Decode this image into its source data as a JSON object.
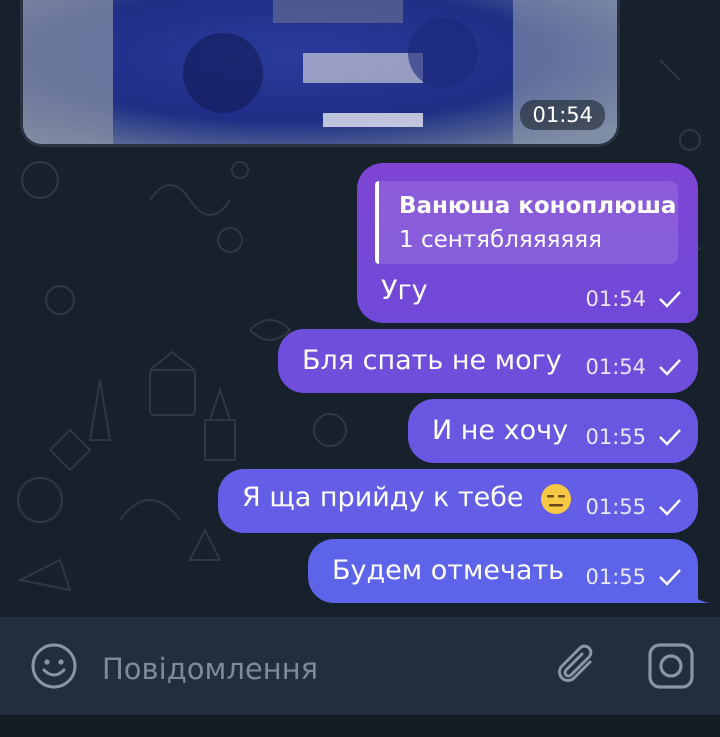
{
  "media_message": {
    "time": "01:54"
  },
  "messages": [
    {
      "reply": {
        "name": "Ванюша коноплюша",
        "text": "1 сентябляяяяяя"
      },
      "text": "Угу",
      "time": "01:54"
    },
    {
      "text": "Бля спать не могу",
      "time": "01:54"
    },
    {
      "text": "И не хочу",
      "time": "01:55"
    },
    {
      "text": "Я ща прийду к тебе",
      "emoji": "expressionless-face-emoji",
      "time": "01:55"
    },
    {
      "text": "Будем отмечать",
      "time": "01:55"
    }
  ],
  "composer": {
    "placeholder": "Повідомлення",
    "emoji_icon": "smiley-icon",
    "attach_icon": "paperclip-icon",
    "camera_icon": "camera-icon"
  },
  "colors": {
    "chat_background": "#17212b",
    "outgoing_bubble_top": "#7f45d4",
    "outgoing_bubble_bottom": "#5e64ea",
    "composer_background": "#232e3c"
  }
}
